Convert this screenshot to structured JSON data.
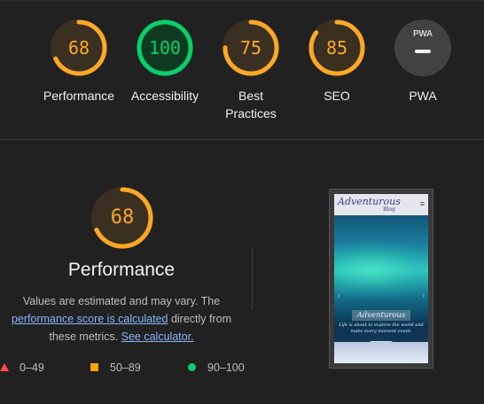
{
  "scores": [
    {
      "label": "Performance",
      "score": "68",
      "color": "#ffa726",
      "fill": 0.68,
      "bg": "#3a3021"
    },
    {
      "label": "Accessibility",
      "score": "100",
      "color": "#0cce6b",
      "fill": 1.0,
      "bg": "#0f3a22"
    },
    {
      "label": "Best\nPractices",
      "score": "75",
      "color": "#ffa726",
      "fill": 0.75,
      "bg": "#3a3021"
    },
    {
      "label": "SEO",
      "score": "85",
      "color": "#ffa726",
      "fill": 0.85,
      "bg": "#3a3021"
    }
  ],
  "pwa": {
    "label": "PWA",
    "badge_text": "PWA"
  },
  "performance": {
    "score": "68",
    "fill": 0.68,
    "title": "Performance",
    "desc_part1": "Values are estimated and may vary. The",
    "desc_link1": "performance score is calculated",
    "desc_part2": " directly from",
    "desc_part3": "these metrics. ",
    "desc_link2": "See calculator."
  },
  "legend": [
    {
      "range": "0–49",
      "color": "#ff4e42"
    },
    {
      "range": "50–89",
      "color": "#ffa400"
    },
    {
      "range": "90–100",
      "color": "#0cce6b"
    }
  ],
  "thumbnail": {
    "logo": "Adventurous",
    "logo_sub": "Blog",
    "caption_title": "Adventurous",
    "caption_sub": "Life is about to explore the world and make every moment count.",
    "button": "Explore",
    "menu_glyph": "≡",
    "prev_glyph": "‹",
    "next_glyph": "›"
  }
}
